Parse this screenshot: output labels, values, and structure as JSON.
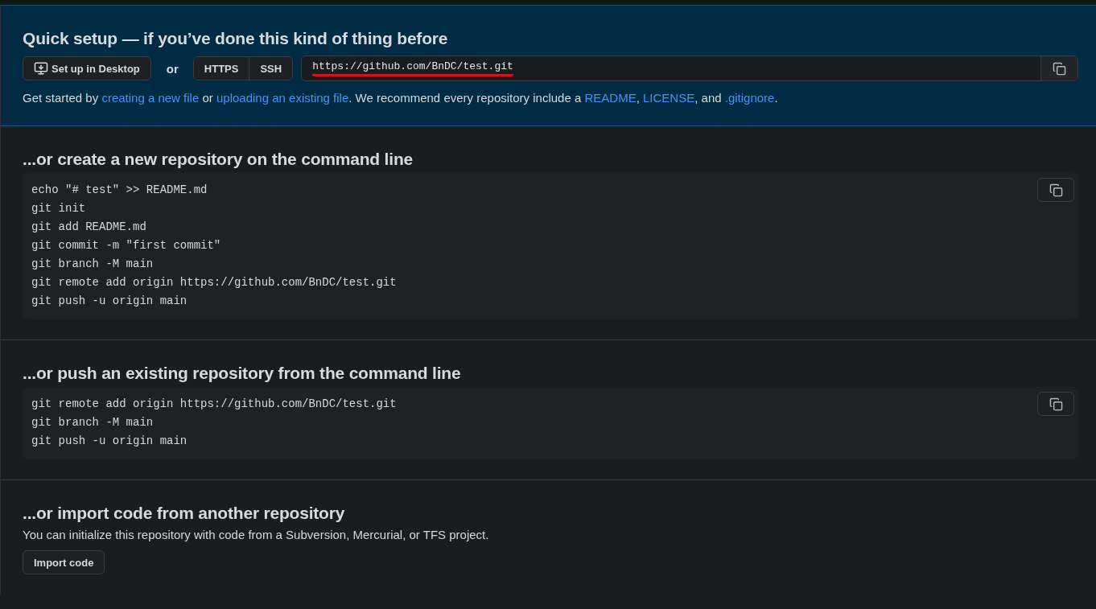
{
  "quick_setup": {
    "title": "Quick setup — if you’ve done this kind of thing before",
    "desktop_button": "Set up in Desktop",
    "or_label": "or",
    "protocol_tabs": [
      {
        "label": "HTTPS"
      },
      {
        "label": "SSH"
      }
    ],
    "clone_url": "https://github.com/BnDC/test.git",
    "url_underlined": true,
    "intro": [
      {
        "text": "Get started by ",
        "link": false
      },
      {
        "text": "creating a new file",
        "link": true
      },
      {
        "text": " or ",
        "link": false
      },
      {
        "text": "uploading an existing file",
        "link": true
      },
      {
        "text": ". We recommend every repository include a ",
        "link": false
      },
      {
        "text": "README",
        "link": true
      },
      {
        "text": ", ",
        "link": false
      },
      {
        "text": "LICENSE",
        "link": true
      },
      {
        "text": ", and ",
        "link": false
      },
      {
        "text": ".gitignore",
        "link": true
      },
      {
        "text": ".",
        "link": false
      }
    ]
  },
  "sections": [
    {
      "kind": "code",
      "title": "...or create a new repository on the command line",
      "lines": [
        "echo \"# test\" >> README.md",
        "git init",
        "git add README.md",
        "git commit -m \"first commit\"",
        "git branch -M main",
        "git remote add origin https://github.com/BnDC/test.git",
        "git push -u origin main"
      ]
    },
    {
      "kind": "code",
      "title": "...or push an existing repository from the command line",
      "lines": [
        "git remote add origin https://github.com/BnDC/test.git",
        "git branch -M main",
        "git push -u origin main"
      ]
    },
    {
      "kind": "import",
      "title": "...or import code from another repository",
      "description": "You can initialize this repository with code from a Subversion, Mercurial, or TFS project.",
      "button": "Import code"
    }
  ]
}
